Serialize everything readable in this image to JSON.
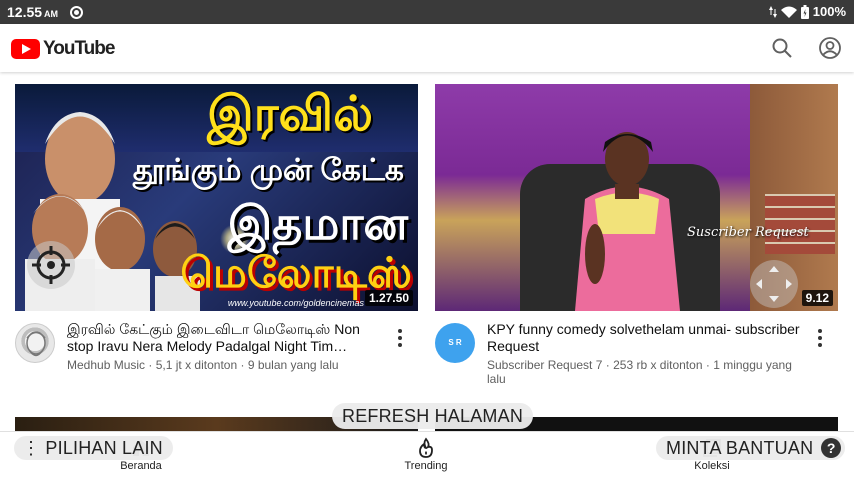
{
  "status_bar": {
    "time": "12.55",
    "ampm": "AM",
    "battery": "100%"
  },
  "app_bar": {
    "logo_text": "YouTube"
  },
  "videos": [
    {
      "thumb_lines": [
        "இரவில்",
        "தூங்கும் முன் கேட்க",
        "இதமான",
        "மெலோடிஸ்"
      ],
      "thumb_url": "www.youtube.com/goldencinemas",
      "duration": "1.27.50",
      "title": "இரவில் கேட்கும் இடைவிடா மெலோடிஸ் Non stop Iravu Nera Melody Padalgal Night Tim…",
      "channel": "Medhub Music",
      "views": "5,1 jt x ditonton",
      "age": "9 bulan yang lalu"
    },
    {
      "thumb_caption": "Suscriber Request",
      "duration": "9.12",
      "title": "KPY funny comedy solvethelam unmai- subscriber Request",
      "avatar_text": "S R",
      "channel": "Subscriber Request 7",
      "views": "253 rb x ditonton",
      "age": "1 minggu yang lalu"
    }
  ],
  "bottom_nav": {
    "home": "Beranda",
    "trending": "Trending",
    "library": "Koleksi"
  },
  "overlays": {
    "refresh": "REFRESH HALAMAN",
    "more_options": "PILIHAN LAIN",
    "help": "MINTA BANTUAN",
    "help_icon": "?"
  },
  "colors": {
    "brand_red": "#ff0000",
    "status_bar": "#3a3a3a"
  }
}
